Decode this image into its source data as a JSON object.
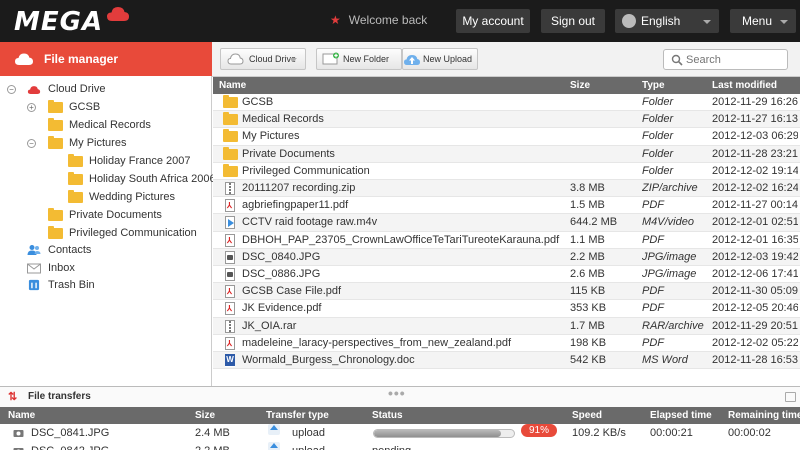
{
  "header": {
    "logo": "MEGA",
    "welcome": "Welcome back",
    "my_account": "My account",
    "sign_out": "Sign out",
    "language": "English",
    "menu": "Menu"
  },
  "sidebar": {
    "title": "File manager",
    "tree": [
      {
        "label": "Cloud Drive"
      },
      {
        "label": "GCSB"
      },
      {
        "label": "Medical Records"
      },
      {
        "label": "My Pictures"
      },
      {
        "label": "Holiday France 2007"
      },
      {
        "label": "Holiday South Africa 2006"
      },
      {
        "label": "Wedding Pictures"
      },
      {
        "label": "Private Documents"
      },
      {
        "label": "Privileged Communication"
      },
      {
        "label": "Contacts"
      },
      {
        "label": "Inbox"
      },
      {
        "label": "Trash Bin"
      }
    ]
  },
  "toolbar": {
    "cloud_drive": "Cloud Drive",
    "new_folder": "New Folder",
    "new_upload": "New Upload",
    "search_placeholder": "Search"
  },
  "files": {
    "columns": {
      "name": "Name",
      "size": "Size",
      "type": "Type",
      "modified": "Last modified"
    },
    "rows": [
      {
        "name": "GCSB",
        "size": "",
        "type": "Folder",
        "modified": "2012-11-29 16:26",
        "icon": "folder-icon"
      },
      {
        "name": "Medical Records",
        "size": "",
        "type": "Folder",
        "modified": "2012-11-27 16:13",
        "icon": "folder-icon"
      },
      {
        "name": "My Pictures",
        "size": "",
        "type": "Folder",
        "modified": "2012-12-03 06:29",
        "icon": "folder-icon"
      },
      {
        "name": "Private Documents",
        "size": "",
        "type": "Folder",
        "modified": "2012-11-28 23:21",
        "icon": "folder-icon"
      },
      {
        "name": "Privileged Communication",
        "size": "",
        "type": "Folder",
        "modified": "2012-12-02 19:14",
        "icon": "folder-icon"
      },
      {
        "name": "20111207 recording.zip",
        "size": "3.8 MB",
        "type": "ZIP/archive",
        "modified": "2012-12-02 16:24",
        "icon": "zip-icon"
      },
      {
        "name": "agbriefingpaper11.pdf",
        "size": "1.5 MB",
        "type": "PDF",
        "modified": "2012-11-27 00:14",
        "icon": "pdf-icon"
      },
      {
        "name": "CCTV raid footage raw.m4v",
        "size": "644.2 MB",
        "type": "M4V/video",
        "modified": "2012-12-01 02:51",
        "icon": "video-icon"
      },
      {
        "name": "DBHOH_PAP_23705_CrownLawOfficeTeTariTureoteKarauna.pdf",
        "size": "1.1 MB",
        "type": "PDF",
        "modified": "2012-12-01 16:35",
        "icon": "pdf-icon"
      },
      {
        "name": "DSC_0840.JPG",
        "size": "2.2 MB",
        "type": "JPG/image",
        "modified": "2012-12-03 19:42",
        "icon": "image-icon"
      },
      {
        "name": "DSC_0886.JPG",
        "size": "2.6 MB",
        "type": "JPG/image",
        "modified": "2012-12-06 17:41",
        "icon": "image-icon"
      },
      {
        "name": "GCSB Case File.pdf",
        "size": "115 KB",
        "type": "PDF",
        "modified": "2012-11-30 05:09",
        "icon": "pdf-icon"
      },
      {
        "name": "JK Evidence.pdf",
        "size": "353 KB",
        "type": "PDF",
        "modified": "2012-12-05 20:46",
        "icon": "pdf-icon"
      },
      {
        "name": "JK_OIA.rar",
        "size": "1.7 MB",
        "type": "RAR/archive",
        "modified": "2012-11-29 20:51",
        "icon": "zip-icon"
      },
      {
        "name": "madeleine_laracy-perspectives_from_new_zealand.pdf",
        "size": "198 KB",
        "type": "PDF",
        "modified": "2012-12-02 05:22",
        "icon": "pdf-icon"
      },
      {
        "name": "Wormald_Burgess_Chronology.doc",
        "size": "542 KB",
        "type": "MS Word",
        "modified": "2012-11-28 16:53",
        "icon": "word-icon"
      }
    ]
  },
  "transfers": {
    "title": "File transfers",
    "columns": {
      "name": "Name",
      "size": "Size",
      "type": "Transfer type",
      "status": "Status",
      "speed": "Speed",
      "elapsed": "Elapsed time",
      "remaining": "Remaining time"
    },
    "rows": [
      {
        "name": "DSC_0841.JPG",
        "size": "2.4 MB",
        "type": "upload",
        "progress": 0.91,
        "percent": "91%",
        "speed": "109.2 KB/s",
        "elapsed": "00:00:21",
        "remaining": "00:00:02"
      },
      {
        "name": "DSC_0842.JPG",
        "size": "2.2 MB",
        "type": "upload",
        "status": "pending",
        "speed": "",
        "elapsed": "",
        "remaining": ""
      }
    ]
  },
  "colors": {
    "accent": "#e84a3a",
    "topbar": "#1b1b1b",
    "header_row": "#6a6a6a",
    "folder": "#f3bb33"
  }
}
